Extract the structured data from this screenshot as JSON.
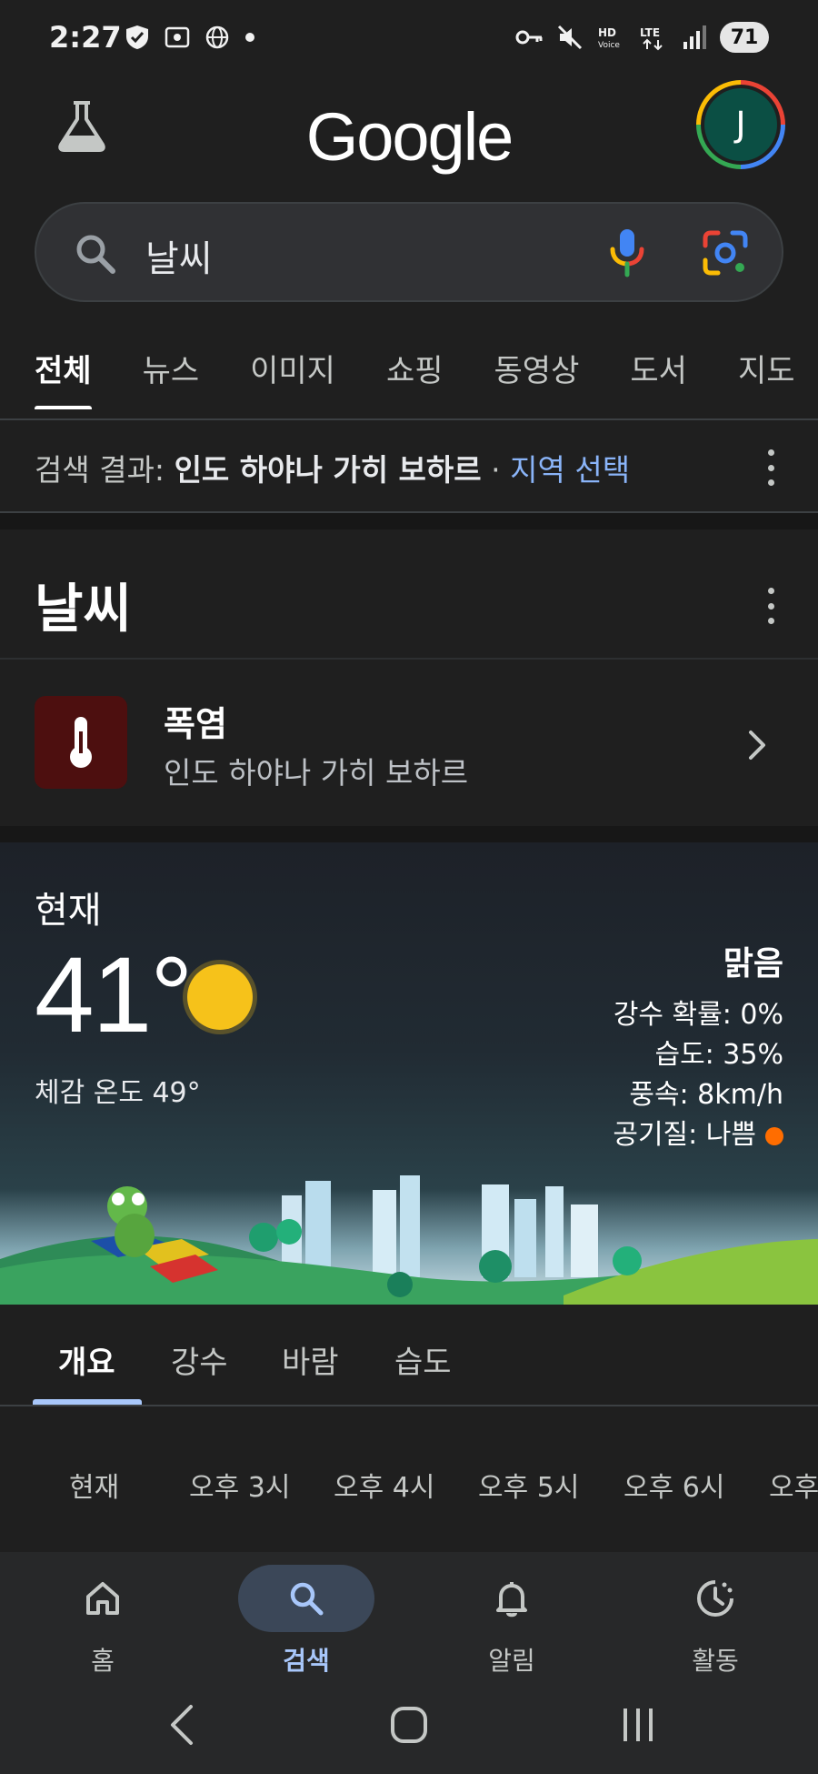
{
  "status_bar": {
    "time": "2:27",
    "battery": "71"
  },
  "header": {
    "logo": "Google",
    "avatar_initial": "J"
  },
  "search": {
    "query": "날씨"
  },
  "tabs": [
    "전체",
    "뉴스",
    "이미지",
    "쇼핑",
    "동영상",
    "도서",
    "지도"
  ],
  "location": {
    "prefix": "검색 결과:",
    "place": "인도 하야나 가히 보하르",
    "sep": "·",
    "link": "지역 선택"
  },
  "weather": {
    "title": "날씨",
    "alert": {
      "title": "폭염",
      "subtitle": "인도 하야나 가히 보하르"
    },
    "now_label": "현재",
    "temperature": "41°",
    "feels_like": "체감 온도 49°",
    "condition": "맑음",
    "precip": "강수 확률: 0%",
    "humidity": "습도: 35%",
    "wind": "풍속: 8km/h",
    "air_quality": "공기질: 나쁨",
    "air_quality_color": "#ff6d00"
  },
  "detail_tabs": [
    "개요",
    "강수",
    "바람",
    "습도"
  ],
  "hours": [
    "현재",
    "오후 3시",
    "오후 4시",
    "오후 5시",
    "오후 6시",
    "오후"
  ],
  "bottom_nav": [
    {
      "label": "홈",
      "icon": "home-icon"
    },
    {
      "label": "검색",
      "icon": "search-icon"
    },
    {
      "label": "알림",
      "icon": "bell-icon"
    },
    {
      "label": "활동",
      "icon": "activity-icon"
    }
  ]
}
